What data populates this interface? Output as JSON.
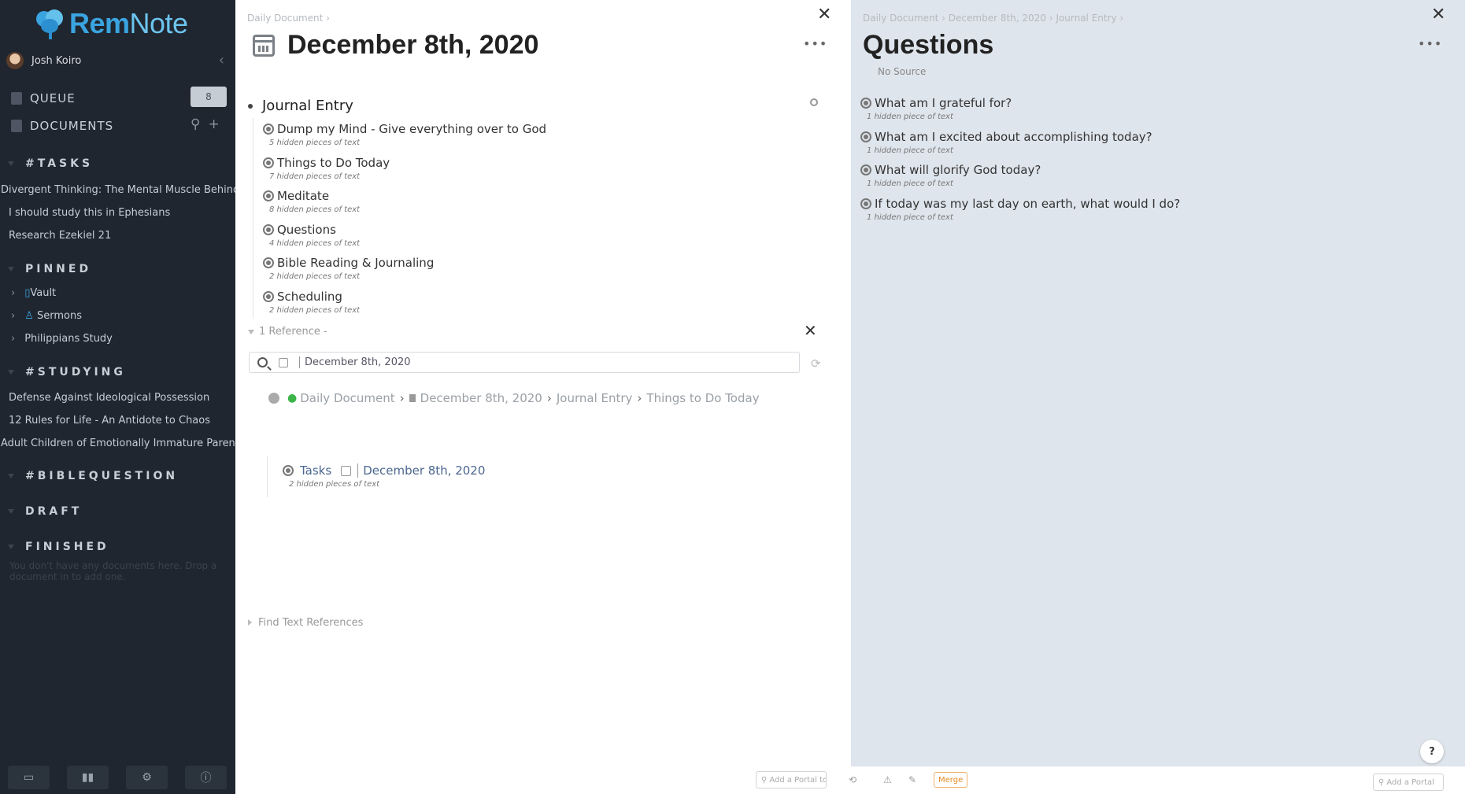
{
  "sidebar": {
    "logo": {
      "rem": "Rem",
      "note": "Note"
    },
    "user_name": "Josh Koiro",
    "queue_label": "QUEUE",
    "queue_count": "8",
    "documents_label": "DOCUMENTS",
    "sections": {
      "tasks": {
        "title": "#TASKS",
        "items": [
          "Divergent Thinking: The Mental Muscle Behind",
          "I should study this in Ephesians",
          "Research Ezekiel 21"
        ]
      },
      "pinned": {
        "title": "PINNED",
        "items": [
          "Vault",
          "Sermons",
          "Philippians Study"
        ]
      },
      "studying": {
        "title": "#STUDYING",
        "items": [
          "Defense Against Ideological Possession",
          "12 Rules for Life - An Antidote to Chaos",
          "Adult Children of Emotionally Immature Parents"
        ]
      },
      "biblequestion": {
        "title": "#BIBLEQUESTION"
      },
      "draft": {
        "title": "DRAFT"
      },
      "finished": {
        "title": "FINISHED",
        "empty_note": "You don't have any documents here. Drop a document in to add one."
      }
    }
  },
  "center": {
    "breadcrumb": "Daily Document ›",
    "title": "December 8th, 2020",
    "rem": "Journal Entry",
    "children": [
      {
        "label": "Dump my Mind - Give everything over to God",
        "hidden": "5 hidden pieces of text"
      },
      {
        "label": "Things to Do Today",
        "hidden": "7 hidden pieces of text"
      },
      {
        "label": "Meditate",
        "hidden": "8 hidden pieces of text"
      },
      {
        "label": "Questions",
        "hidden": "4 hidden pieces of text"
      },
      {
        "label": "Bible Reading & Journaling",
        "hidden": "2 hidden pieces of text"
      },
      {
        "label": "Scheduling",
        "hidden": "2 hidden pieces of text"
      }
    ],
    "references_label": "1 Reference -",
    "search_value": "December 8th, 2020",
    "ref_path": [
      "Daily Document",
      "December 8th, 2020",
      "Journal Entry",
      "Things to Do Today"
    ],
    "ref_block": {
      "label": "Tasks",
      "date": "December 8th, 2020",
      "hidden": "2 hidden pieces of text"
    },
    "find_text_refs": "Find Text References"
  },
  "right": {
    "breadcrumb": [
      "Daily Document",
      "December 8th, 2020",
      "Journal Entry"
    ],
    "title": "Questions",
    "no_source": "No Source",
    "items": [
      {
        "label": "What am I grateful for?",
        "hidden": "1 hidden piece of text"
      },
      {
        "label": "What am I excited about accomplishing today?",
        "hidden": "1 hidden piece of text"
      },
      {
        "label": "What will glorify God today?",
        "hidden": "1 hidden piece of text"
      },
      {
        "label": "If today was my last day on earth, what would I do?",
        "hidden": "1 hidden piece of text"
      }
    ]
  },
  "bottom": {
    "portal_placeholder_left": "Add a Portal to an e",
    "merge_label": "Merge",
    "portal_placeholder_right": "Add a Portal",
    "help_label": "?"
  },
  "icons": [
    "calendar-icon",
    "close-icon",
    "more-icon",
    "search-icon",
    "refresh-icon",
    "gear-icon",
    "help-icon"
  ]
}
